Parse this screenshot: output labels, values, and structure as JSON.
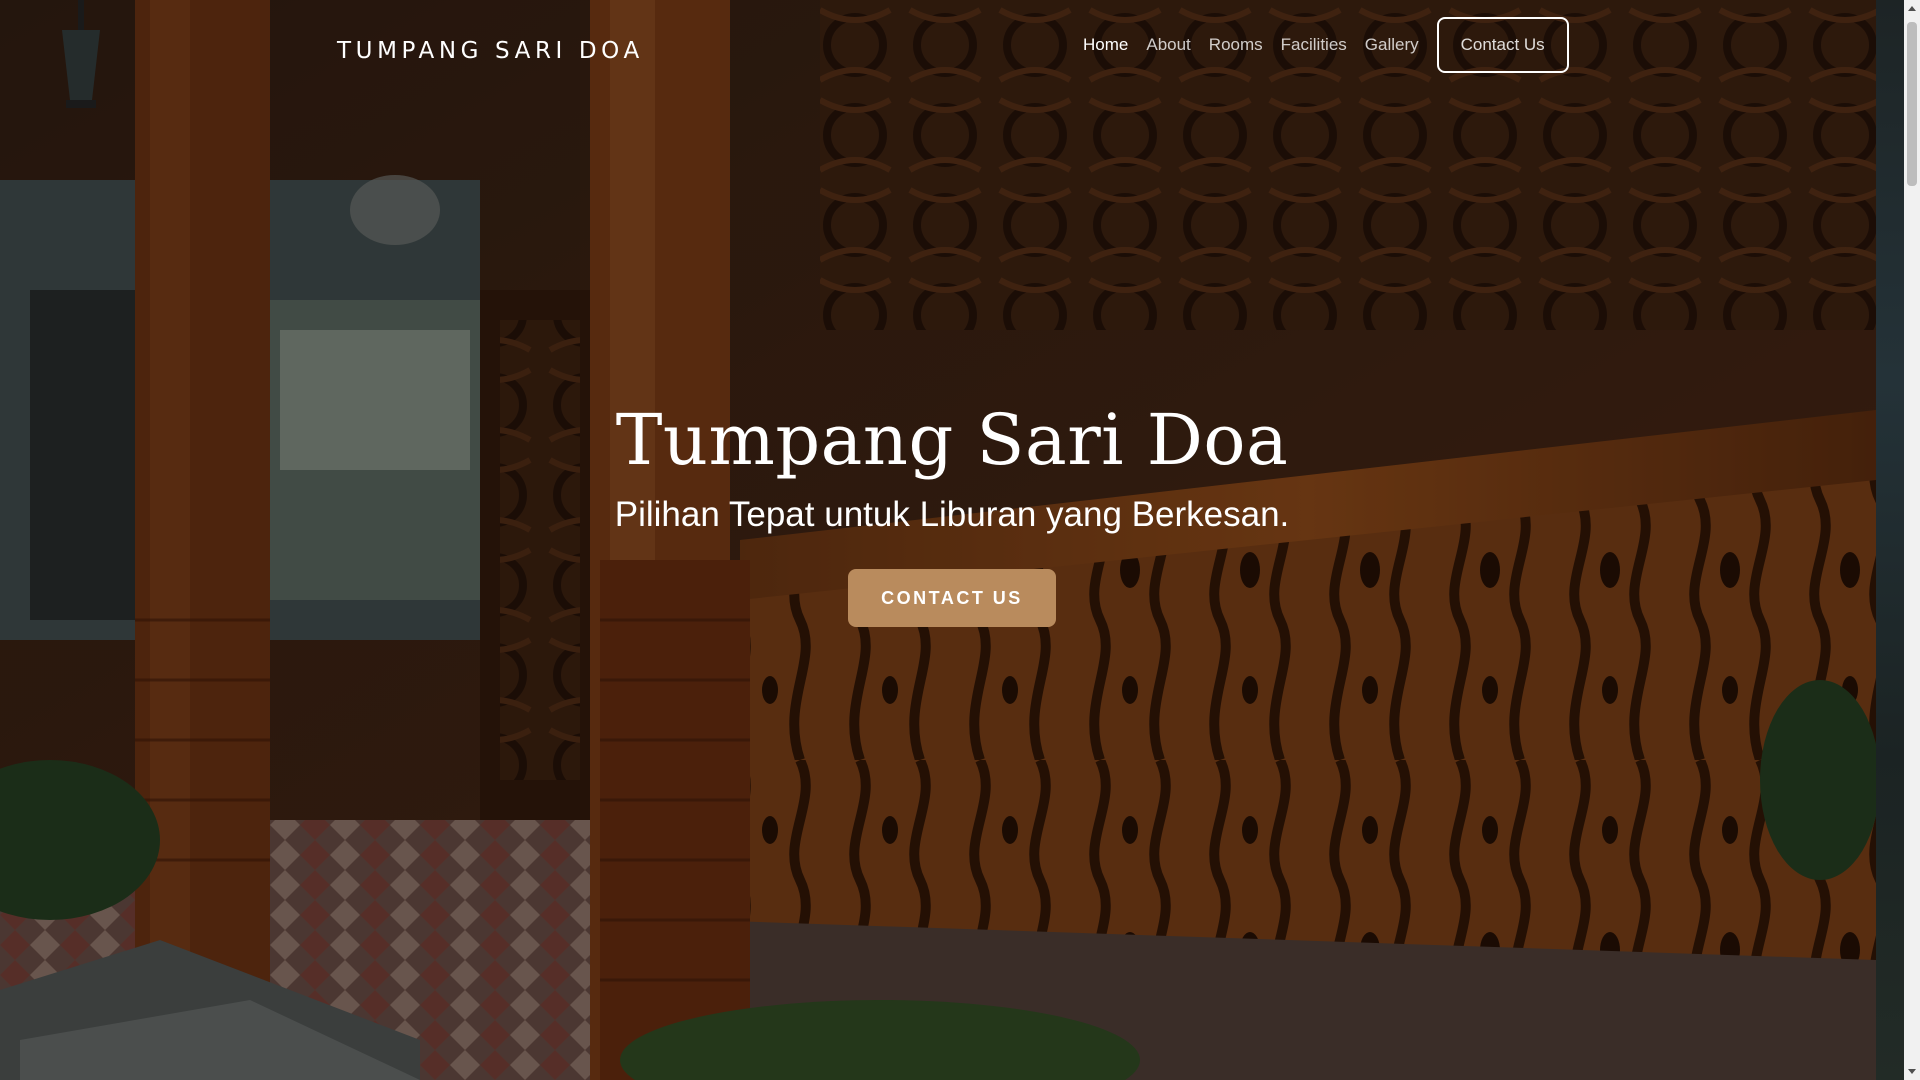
{
  "brand": {
    "name": "TUMPANG SARI DOA"
  },
  "nav": {
    "items": [
      {
        "label": "Home",
        "active": true
      },
      {
        "label": "About",
        "active": false
      },
      {
        "label": "Rooms",
        "active": false
      },
      {
        "label": "Facilities",
        "active": false
      },
      {
        "label": "Gallery",
        "active": false
      }
    ],
    "cta_label": "Contact Us"
  },
  "hero": {
    "title": "Tumpang Sari Doa",
    "subtitle": "Pilihan Tepat untuk Liburan yang Berkesan.",
    "button_label": "CONTACT US",
    "background_image": "traditional Javanese carved wooden joglo veranda"
  },
  "colors": {
    "accent": "#b98b5d",
    "text": "#ffffff",
    "wood": "#7a3f1c"
  }
}
